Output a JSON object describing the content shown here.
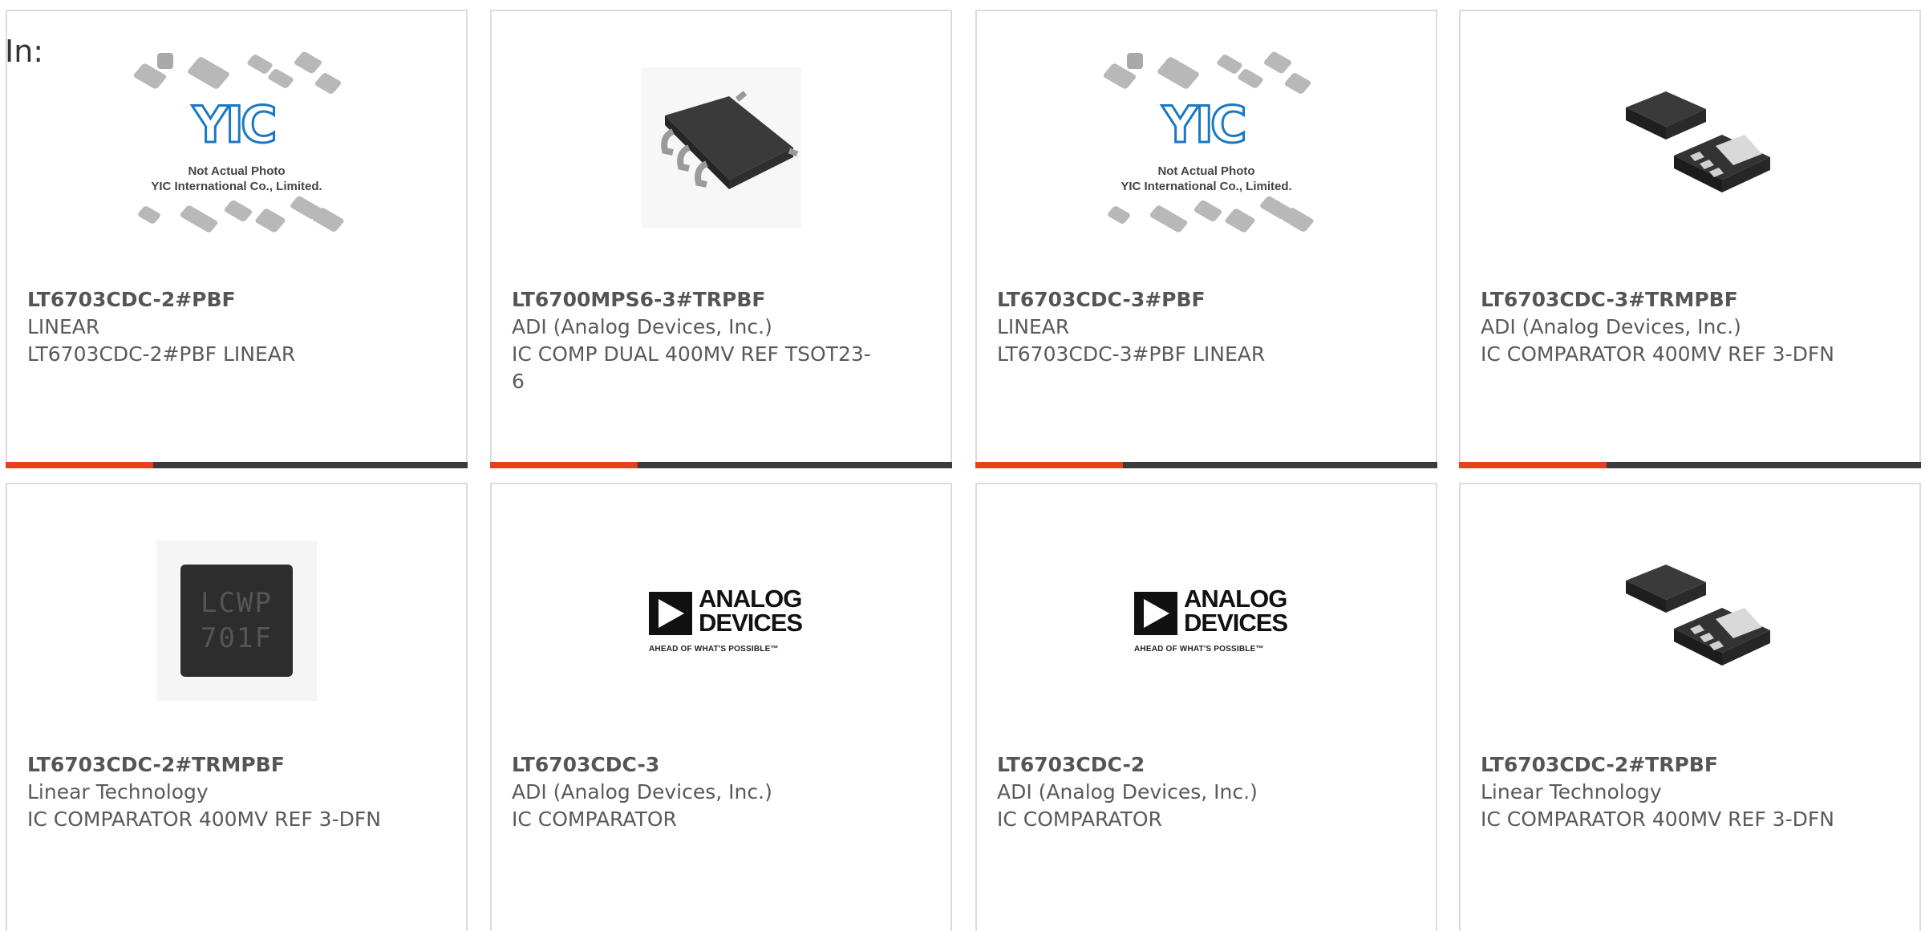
{
  "header": {
    "in_label": "In:"
  },
  "placeholder_caption": {
    "line1": "Not Actual Photo",
    "line2": "YIC International Co., Limited.",
    "logo": "YIC"
  },
  "adi_logo": {
    "line1": "ANALOG",
    "line2": "DEVICES",
    "tagline": "AHEAD OF WHAT'S POSSIBLE™"
  },
  "marking": {
    "line1": "LCWP",
    "line2": "701F"
  },
  "colors": {
    "accent": "#e8401c",
    "bar": "#3b3b3b",
    "border": "#dcdcdc"
  },
  "products": [
    {
      "part": "LT6703CDC-2#PBF",
      "manufacturer": "LINEAR",
      "description": "LT6703CDC-2#PBF LINEAR",
      "image": "yic-placeholder"
    },
    {
      "part": "LT6700MPS6-3#TRPBF",
      "manufacturer": "ADI (Analog Devices, Inc.)",
      "description": "IC COMP DUAL 400MV REF TSOT23-6",
      "image": "sot23-package"
    },
    {
      "part": "LT6703CDC-3#PBF",
      "manufacturer": "LINEAR",
      "description": "LT6703CDC-3#PBF LINEAR",
      "image": "yic-placeholder"
    },
    {
      "part": "LT6703CDC-3#TRMPBF",
      "manufacturer": "ADI (Analog Devices, Inc.)",
      "description": "IC COMPARATOR 400MV REF 3-DFN",
      "image": "dfn-package"
    },
    {
      "part": "LT6703CDC-2#TRMPBF",
      "manufacturer": "Linear Technology",
      "description": "IC COMPARATOR 400MV REF 3-DFN",
      "image": "marking-photo"
    },
    {
      "part": "LT6703CDC-3",
      "manufacturer": "ADI (Analog Devices, Inc.)",
      "description": "IC COMPARATOR",
      "image": "adi-logo"
    },
    {
      "part": "LT6703CDC-2",
      "manufacturer": "ADI (Analog Devices, Inc.)",
      "description": "IC COMPARATOR",
      "image": "adi-logo"
    },
    {
      "part": "LT6703CDC-2#TRPBF",
      "manufacturer": "Linear Technology",
      "description": "IC COMPARATOR 400MV REF 3-DFN",
      "image": "dfn-package"
    }
  ]
}
